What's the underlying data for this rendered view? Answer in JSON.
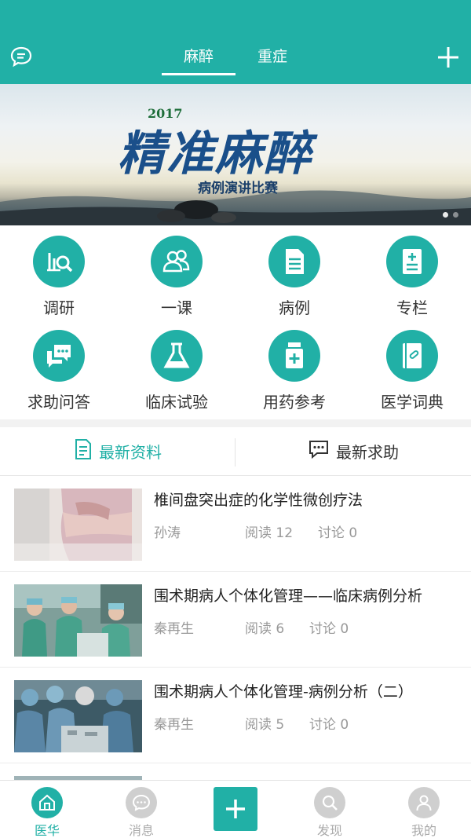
{
  "header": {
    "tabs": [
      {
        "label": "麻醉",
        "active": true
      },
      {
        "label": "重症",
        "active": false
      }
    ],
    "left_icon": "chat-bubble-icon",
    "right_icon": "plus-icon"
  },
  "banner": {
    "year": "2017",
    "headline": "精准麻醉",
    "subline": "病例演讲比赛"
  },
  "grid": [
    {
      "label": "调研",
      "icon": "survey-chart-icon"
    },
    {
      "label": "一课",
      "icon": "people-icon"
    },
    {
      "label": "病例",
      "icon": "document-icon"
    },
    {
      "label": "专栏",
      "icon": "clipboard-plus-icon"
    },
    {
      "label": "求助问答",
      "icon": "chat-bubbles-icon"
    },
    {
      "label": "临床试验",
      "icon": "flask-icon"
    },
    {
      "label": "用药参考",
      "icon": "medicine-bottle-icon"
    },
    {
      "label": "医学词典",
      "icon": "dictionary-icon"
    }
  ],
  "sections": {
    "latest_materials": "最新资料",
    "latest_help": "最新求助"
  },
  "articles": [
    {
      "title": "椎间盘突出症的化学性微创疗法",
      "author": "孙涛",
      "reads": "阅读 12",
      "comments": "讨论 0"
    },
    {
      "title": "围术期病人个体化管理——临床病例分析",
      "author": "秦再生",
      "reads": "阅读 6",
      "comments": "讨论 0"
    },
    {
      "title": "围术期病人个体化管理-病例分析（二）",
      "author": "秦再生",
      "reads": "阅读 5",
      "comments": "讨论 0"
    }
  ],
  "bottom_nav": [
    {
      "label": "医华",
      "icon": "home-icon",
      "active": true
    },
    {
      "label": "消息",
      "icon": "message-icon",
      "active": false
    },
    {
      "label": "发现",
      "icon": "discover-search-icon",
      "active": false
    },
    {
      "label": "我的",
      "icon": "profile-icon",
      "active": false
    }
  ],
  "colors": {
    "accent": "#21b0a6",
    "inactive": "#cfcfcf",
    "text": "#333333",
    "meta": "#999999"
  }
}
